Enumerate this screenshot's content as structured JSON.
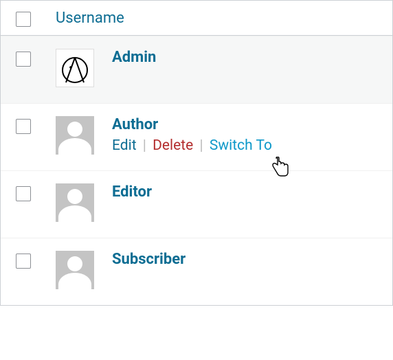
{
  "header": {
    "username_col": "Username"
  },
  "rows": [
    {
      "username": "Admin",
      "avatar": "custom",
      "hovered": true,
      "show_actions": false
    },
    {
      "username": "Author",
      "avatar": "default",
      "hovered": false,
      "show_actions": true
    },
    {
      "username": "Editor",
      "avatar": "default",
      "hovered": false,
      "show_actions": false
    },
    {
      "username": "Subscriber",
      "avatar": "default",
      "hovered": false,
      "show_actions": false
    }
  ],
  "actions": {
    "edit": "Edit",
    "delete": "Delete",
    "switch_to": "Switch To",
    "separator": "|"
  }
}
